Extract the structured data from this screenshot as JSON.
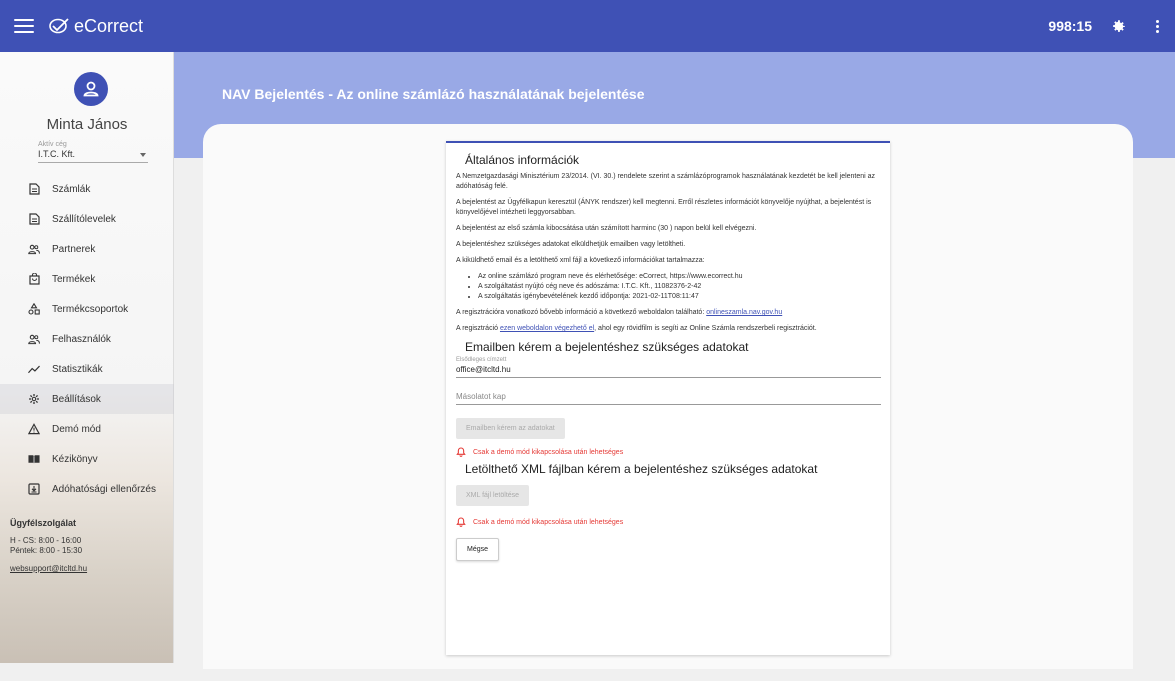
{
  "app": {
    "name": "eCorrect",
    "timer": "998:15"
  },
  "sidebar": {
    "user_name": "Minta János",
    "company_label": "Aktív cég",
    "company_value": "I.T.C. Kft.",
    "items": [
      {
        "label": "Számlák",
        "icon": "document-icon"
      },
      {
        "label": "Szállítólevelek",
        "icon": "document-icon"
      },
      {
        "label": "Partnerek",
        "icon": "people-icon"
      },
      {
        "label": "Termékek",
        "icon": "bag-icon"
      },
      {
        "label": "Termékcsoportok",
        "icon": "shapes-icon"
      },
      {
        "label": "Felhasználók",
        "icon": "people-icon"
      },
      {
        "label": "Statisztikák",
        "icon": "trend-icon"
      },
      {
        "label": "Beállítások",
        "icon": "gear-icon"
      },
      {
        "label": "Demó mód",
        "icon": "warning-icon"
      },
      {
        "label": "Kézikönyv",
        "icon": "book-icon"
      },
      {
        "label": "Adóhatósági ellenőrzés",
        "icon": "download-box-icon"
      }
    ],
    "support": {
      "title": "Ügyfélszolgálat",
      "hours1": "H - CS: 8:00 - 16:00",
      "hours2": "Péntek: 8:00 - 15:30",
      "email": "websupport@itcltd.hu"
    }
  },
  "page": {
    "title": "NAV Bejelentés - Az online számlázó használatának bejelentése"
  },
  "card": {
    "heading": "Általános információk",
    "p1": "A Nemzetgazdasági Minisztérium 23/2014. (VI. 30.) rendelete szerint a számlázóprogramok használatának kezdetét be kell jelenteni az adóhatóság felé.",
    "p2": "A bejelentést az Ügyfélkapun keresztül (ÁNYK rendszer) kell megtenni. Erről részletes információt könyvelője nyújthat, a bejelentést is könyvelőjével intézheti leggyorsabban.",
    "p3": "A bejelentést az első számla kibocsátása után számított harminc (30 ) napon belül kell elvégezni.",
    "p4": "A bejelentéshez szükséges adatokat elküldhetjük emailben vagy letöltheti.",
    "p5": "A kiküldhető email és a letölthető xml fájl a következő információkat tartalmazza:",
    "bullets": [
      "Az online számlázó program neve és elérhetősége: eCorrect, https://www.ecorrect.hu",
      "A szolgáltatást nyújtó cég neve és adószáma: I.T.C. Kft., 11082376-2-42",
      "A szolgáltatás igénybevételének kezdő időpontja: 2021-02-11T08:11:47"
    ],
    "p6_prefix": "A regisztrációra vonatkozó bővebb információ a következő weboldalon található: ",
    "p6_link": "onlineszamla.nav.gov.hu",
    "p7_prefix": "A regisztráció ",
    "p7_link": "ezen weboldalon végezhető el",
    "p7_suffix": ", ahol egy rövidfilm is segíti az Online Számla rendszerbeli regisztrációt.",
    "email_heading": "Emailben kérem a bejelentéshez szükséges adatokat",
    "primary_label": "Elsődleges címzett",
    "primary_value": "office@itcltd.hu",
    "cc_placeholder": "Másolatot kap",
    "email_button": "Emailben kérem az adatokat",
    "warning": "Csak a demó mód kikapcsolása után lehetséges",
    "xml_heading": "Letölthető XML fájlban kérem a bejelentéshez szükséges adatokat",
    "xml_button": "XML fájl letöltése",
    "cancel_button": "Mégse"
  }
}
